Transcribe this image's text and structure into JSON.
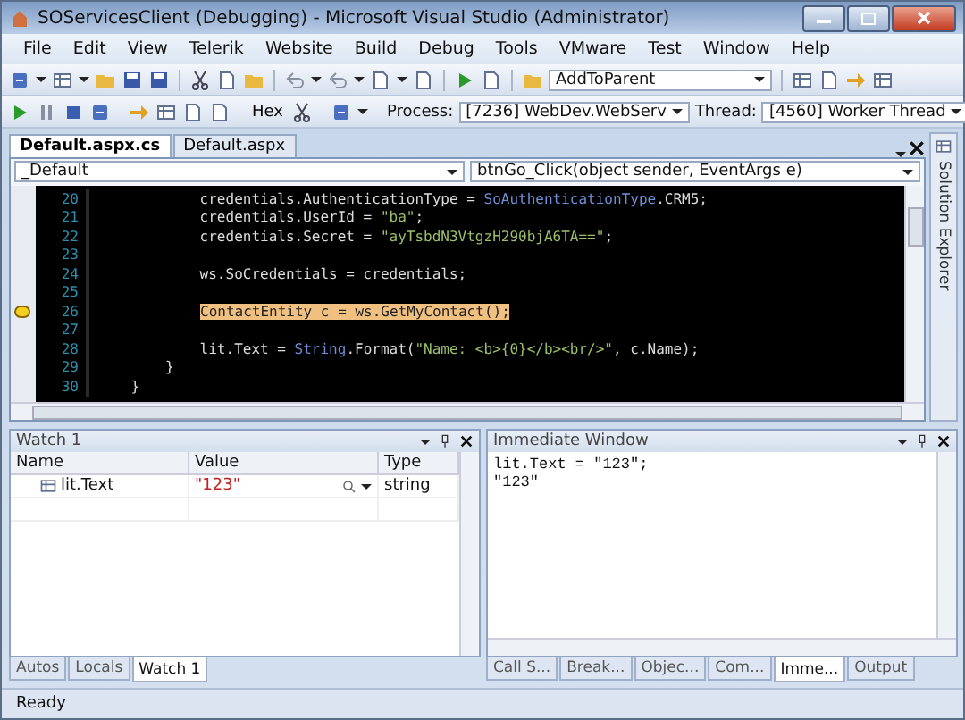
{
  "window": {
    "title": "SOServicesClient (Debugging) - Microsoft Visual Studio (Administrator)"
  },
  "menu": [
    "File",
    "Edit",
    "View",
    "Telerik",
    "Website",
    "Build",
    "Debug",
    "Tools",
    "VMware",
    "Test",
    "Window",
    "Help"
  ],
  "toolbar": {
    "command_combo": "AddToParent",
    "hex_button": "Hex",
    "process_label": "Process:",
    "process_value": "[7236] WebDev.WebServ",
    "thread_label": "Thread:",
    "thread_value": "[4560] Worker Thread"
  },
  "document_tabs": [
    {
      "label": "Default.aspx.cs",
      "selected": true
    },
    {
      "label": "Default.aspx",
      "selected": false
    }
  ],
  "nav_bar": {
    "type_combo": "_Default",
    "member_combo": "btnGo_Click(object sender, EventArgs e)"
  },
  "side_tab": "Solution Explorer",
  "code_lines": [
    {
      "number": "20",
      "current": false,
      "tokens": [
        {
          "text": "            credentials.AuthenticationType = ",
          "kind": "plain"
        },
        {
          "text": "SoAuthenticationType",
          "kind": "type"
        },
        {
          "text": ".CRM5;",
          "kind": "plain"
        }
      ]
    },
    {
      "number": "21",
      "current": false,
      "tokens": [
        {
          "text": "            credentials.UserId = ",
          "kind": "plain"
        },
        {
          "text": "\"ba\"",
          "kind": "string"
        },
        {
          "text": ";",
          "kind": "plain"
        }
      ]
    },
    {
      "number": "22",
      "current": false,
      "tokens": [
        {
          "text": "            credentials.Secret = ",
          "kind": "plain"
        },
        {
          "text": "\"ayTsbdN3VtgzH290bjA6TA==\"",
          "kind": "string"
        },
        {
          "text": ";",
          "kind": "plain"
        }
      ]
    },
    {
      "number": "23",
      "current": false
    },
    {
      "number": "24",
      "current": false,
      "tokens": [
        {
          "text": "            ws.SoCredentials = credentials;",
          "kind": "plain"
        }
      ]
    },
    {
      "number": "25",
      "current": false
    },
    {
      "number": "26",
      "current": true,
      "tokens": [
        {
          "text": "ContactEntity c = ws.GetMyContact();",
          "kind": "plain"
        }
      ]
    },
    {
      "number": "27",
      "current": false
    },
    {
      "number": "28",
      "current": false,
      "tokens": [
        {
          "text": "            lit.Text = ",
          "kind": "plain"
        },
        {
          "text": "String",
          "kind": "type"
        },
        {
          "text": ".Format(",
          "kind": "plain"
        },
        {
          "text": "\"Name: <b>{0}</b><br/>\"",
          "kind": "string"
        },
        {
          "text": ", c.Name);",
          "kind": "plain"
        }
      ]
    },
    {
      "number": "29",
      "current": false,
      "tokens": [
        {
          "text": "        }",
          "kind": "plain"
        }
      ]
    },
    {
      "number": "30",
      "current": false,
      "tokens": [
        {
          "text": "    }",
          "kind": "plain"
        }
      ]
    }
  ],
  "watch": {
    "title": "Watch 1",
    "columns": [
      "Name",
      "Value",
      "Type"
    ],
    "rows": [
      {
        "name": "lit.Text",
        "value": "\"123\"",
        "type": "string",
        "changed": true
      }
    ],
    "tabs": [
      {
        "label": "Autos",
        "selected": false
      },
      {
        "label": "Locals",
        "selected": false
      },
      {
        "label": "Watch 1",
        "selected": true
      }
    ]
  },
  "immediate": {
    "title": "Immediate Window",
    "lines": [
      "lit.Text = \"123\";",
      "\"123\""
    ],
    "tabs": [
      {
        "label": "Call S...",
        "selected": false
      },
      {
        "label": "Break...",
        "selected": false
      },
      {
        "label": "Objec...",
        "selected": false
      },
      {
        "label": "Com...",
        "selected": false
      },
      {
        "label": "Imme...",
        "selected": true
      },
      {
        "label": "Output",
        "selected": false
      }
    ]
  },
  "status_bar": {
    "text": "Ready"
  }
}
